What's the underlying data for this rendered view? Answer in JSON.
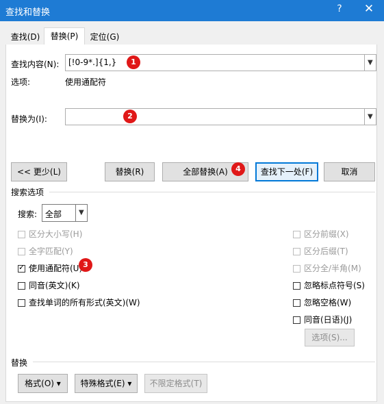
{
  "window": {
    "title": "查找和替换",
    "help_glyph": "?",
    "close_glyph": "✕"
  },
  "tabs": [
    {
      "label": "查找(D)"
    },
    {
      "label": "替换(P)"
    },
    {
      "label": "定位(G)"
    }
  ],
  "find": {
    "label": "查找内容(N):",
    "value": "[!0-9*.]{1,}",
    "options_label": "选项:",
    "options_value": "使用通配符"
  },
  "replace": {
    "label": "替换为(I):",
    "value": ""
  },
  "badges": [
    "1",
    "2",
    "3",
    "4"
  ],
  "buttons": {
    "less": "<< 更少(L)",
    "replace": "替换(R)",
    "replace_all": "全部替换(A)",
    "find_next": "查找下一处(F)",
    "cancel": "取消",
    "options": "选项(S)..."
  },
  "search_options": {
    "section_title": "搜索选项",
    "search_label": "搜索:",
    "search_value": "全部",
    "left_checks": [
      {
        "label": "区分大小写(H)",
        "checked": false,
        "disabled": true
      },
      {
        "label": "全字匹配(Y)",
        "checked": false,
        "disabled": true
      },
      {
        "label": "使用通配符(U)",
        "checked": true,
        "disabled": false
      },
      {
        "label": "同音(英文)(K)",
        "checked": false,
        "disabled": false
      },
      {
        "label": "查找单词的所有形式(英文)(W)",
        "checked": false,
        "disabled": false
      }
    ],
    "right_checks": [
      {
        "label": "区分前缀(X)",
        "checked": false,
        "disabled": true
      },
      {
        "label": "区分后缀(T)",
        "checked": false,
        "disabled": true
      },
      {
        "label": "区分全/半角(M)",
        "checked": false,
        "disabled": true
      },
      {
        "label": "忽略标点符号(S)",
        "checked": false,
        "disabled": false
      },
      {
        "label": "忽略空格(W)",
        "checked": false,
        "disabled": false
      },
      {
        "label": "同音(日语)(J)",
        "checked": false,
        "disabled": false
      }
    ]
  },
  "replace_section": {
    "title": "替换",
    "format_button": "格式(O) ▾",
    "special_button": "特殊格式(E) ▾",
    "no_format_button": "不限定格式(T)"
  },
  "colors": {
    "titlebar": "#1e7bd4",
    "badge": "#e01818",
    "default_button_border": "#0078d7"
  }
}
